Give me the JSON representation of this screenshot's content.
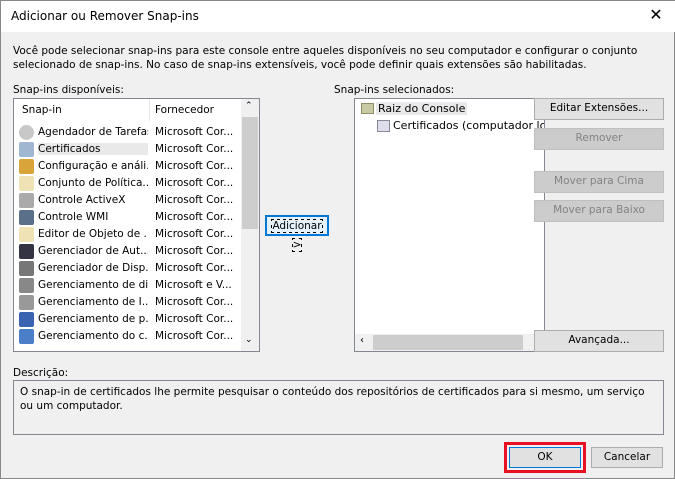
{
  "window": {
    "title": "Adicionar ou Remover Snap-ins",
    "close_icon": "close-icon"
  },
  "intro": "Você pode selecionar snap-ins para este console entre aqueles disponíveis no seu computador e configurar o conjunto selecionado de snap-ins. No caso de snap-ins extensíveis, você pode definir quais extensões são habilitadas.",
  "available": {
    "label": "Snap-ins disponíveis:",
    "columns": [
      "Snap-in",
      "Fornecedor"
    ],
    "items": [
      {
        "name": "Agendador de Tarefas",
        "vendor": "Microsoft Cor...",
        "icon": "clock-icon"
      },
      {
        "name": "Certificados",
        "vendor": "Microsoft Cor...",
        "icon": "certificate-icon",
        "selected": true
      },
      {
        "name": "Configuração e análi...",
        "vendor": "Microsoft Cor...",
        "icon": "server-lock-icon"
      },
      {
        "name": "Conjunto de Política...",
        "vendor": "Microsoft Cor...",
        "icon": "scroll-icon"
      },
      {
        "name": "Controle ActiveX",
        "vendor": "Microsoft Cor...",
        "icon": "activex-icon"
      },
      {
        "name": "Controle WMI",
        "vendor": "Microsoft Cor...",
        "icon": "wmi-icon"
      },
      {
        "name": "Editor de Objeto de ...",
        "vendor": "Microsoft Cor...",
        "icon": "scroll-icon"
      },
      {
        "name": "Gerenciador de Aut...",
        "vendor": "Microsoft Cor...",
        "icon": "authorization-icon"
      },
      {
        "name": "Gerenciador de Disp...",
        "vendor": "Microsoft Cor...",
        "icon": "device-icon"
      },
      {
        "name": "Gerenciamento de di...",
        "vendor": "Microsoft e V...",
        "icon": "disk-icon"
      },
      {
        "name": "Gerenciamento de I...",
        "vendor": "Microsoft Cor...",
        "icon": "printer-icon"
      },
      {
        "name": "Gerenciamento de p...",
        "vendor": "Microsoft Cor...",
        "icon": "computer-key-icon"
      },
      {
        "name": "Gerenciamento do c...",
        "vendor": "Microsoft Cor...",
        "icon": "computer-icon"
      }
    ]
  },
  "add_button": "Adicionar >",
  "selected": {
    "label": "Snap-ins selecionados:",
    "root": "Raiz do Console",
    "child": "Certificados (computador local)"
  },
  "buttons": {
    "edit": "Editar Extensões...",
    "remove": "Remover",
    "up": "Mover para Cima",
    "down": "Mover para Baixo",
    "advanced": "Avançada...",
    "ok": "OK",
    "cancel": "Cancelar"
  },
  "description": {
    "label": "Descrição:",
    "text": "O snap-in de certificados lhe permite pesquisar o conteúdo dos repositórios de certificados para si mesmo, um serviço ou um computador."
  },
  "highlight_color": "#e81123"
}
